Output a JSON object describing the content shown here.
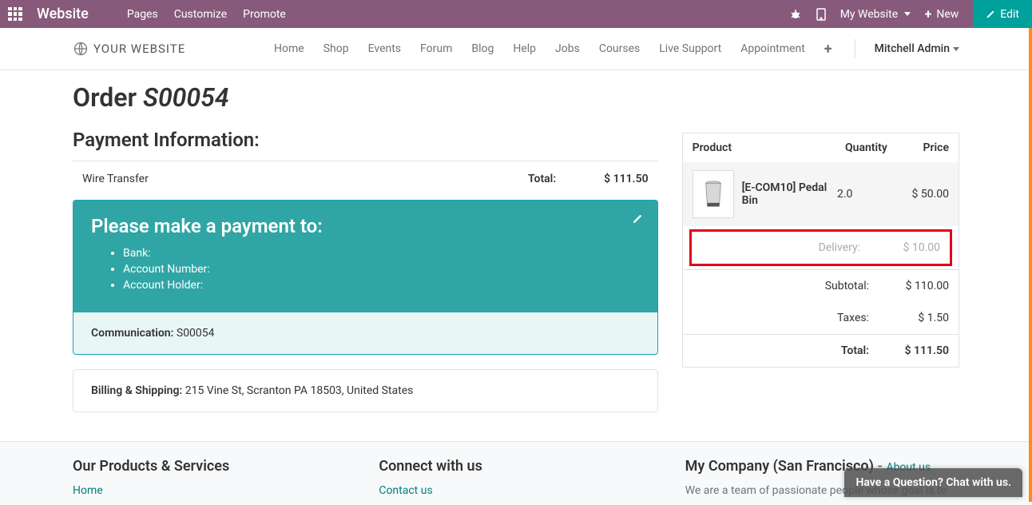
{
  "topbar": {
    "brand": "Website",
    "menu": [
      "Pages",
      "Customize",
      "Promote"
    ],
    "my_website": "My Website",
    "new": "New",
    "edit": "Edit"
  },
  "subnav": {
    "logo_text": "YOUR WEBSITE",
    "menu": [
      "Home",
      "Shop",
      "Events",
      "Forum",
      "Blog",
      "Help",
      "Jobs",
      "Courses",
      "Live Support",
      "Appointment"
    ],
    "user": "Mitchell Admin"
  },
  "order": {
    "title_prefix": "Order ",
    "number": "S00054"
  },
  "payment": {
    "heading": "Payment Information:",
    "method": "Wire Transfer",
    "total_label": "Total:",
    "total_value": "$ 111.50",
    "instruct_title": "Please make a payment to:",
    "fields": [
      "Bank:",
      "Account Number:",
      "Account Holder:"
    ],
    "comm_label": "Communication:",
    "comm_value": "S00054"
  },
  "shipping": {
    "label": "Billing & Shipping:",
    "address": "215 Vine St, Scranton PA 18503, United States"
  },
  "summary": {
    "head_product": "Product",
    "head_qty": "Quantity",
    "head_price": "Price",
    "item": {
      "name": "[E-COM10] Pedal Bin",
      "qty": "2.0",
      "price": "$ 50.00"
    },
    "delivery_label": "Delivery:",
    "delivery_value": "$ 10.00",
    "subtotal_label": "Subtotal:",
    "subtotal_value": "$ 110.00",
    "taxes_label": "Taxes:",
    "taxes_value": "$ 1.50",
    "total_label": "Total:",
    "total_value": "$ 111.50"
  },
  "footer": {
    "col1_h": "Our Products & Services",
    "col1_link": "Home",
    "col2_h": "Connect with us",
    "col2_link": "Contact us",
    "col3_h": "My Company (San Francisco)",
    "col3_sep": " - ",
    "col3_link": "About us",
    "col3_sub": "We are a team of passionate people whose goal is to"
  },
  "chat": "Have a Question? Chat with us."
}
